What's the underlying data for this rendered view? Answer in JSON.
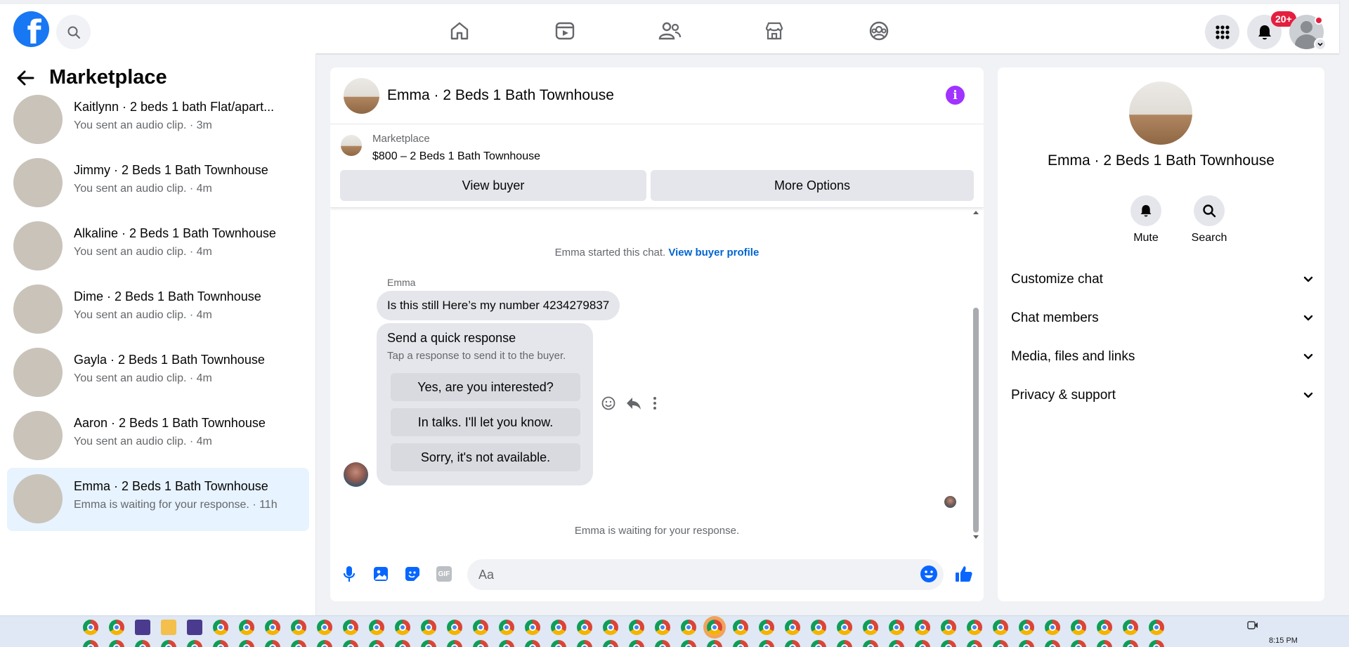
{
  "sidebar": {
    "title": "Marketplace",
    "conversations": [
      {
        "name": "Kaitlynn · 2 beds 1 bath Flat/apart...",
        "sub": "You sent an audio clip. · 3m",
        "thumb": "room-b"
      },
      {
        "name": "Jimmy · 2 Beds 1 Bath Townhouse",
        "sub": "You sent an audio clip. · 4m",
        "thumb": "room-a"
      },
      {
        "name": "Alkaline · 2 Beds 1 Bath Townhouse",
        "sub": "You sent an audio clip. · 4m",
        "thumb": "room-b"
      },
      {
        "name": "Dime · 2 Beds 1 Bath Townhouse",
        "sub": "You sent an audio clip. · 4m",
        "thumb": "room-b"
      },
      {
        "name": "Gayla · 2 Beds 1 Bath Townhouse",
        "sub": "You sent an audio clip. · 4m",
        "thumb": "room-b"
      },
      {
        "name": "Aaron · 2 Beds 1 Bath Townhouse",
        "sub": "You sent an audio clip. · 4m",
        "thumb": "room-b"
      },
      {
        "name": "Emma · 2 Beds 1 Bath Townhouse",
        "sub": "Emma is waiting for your response. · 11h",
        "thumb": "room-c",
        "active": true
      }
    ]
  },
  "topbar": {
    "notification_badge": "20+",
    "icons": [
      "facebook-logo",
      "search-icon",
      "home-icon",
      "video-icon",
      "friends-icon",
      "marketplace-icon",
      "groups-icon",
      "menu-grid-icon",
      "bell-icon",
      "avatar"
    ]
  },
  "chat": {
    "title": "Emma · 2 Beds 1 Bath Townhouse",
    "marketplace_label": "Marketplace",
    "listing": "$800 – 2 Beds 1 Bath Townhouse",
    "view_buyer": "View buyer",
    "more_options": "More Options",
    "started_text": "Emma started this chat.",
    "view_buyer_profile": "View buyer profile",
    "sender": "Emma",
    "message": "Is this still  Here’s my number 4234279837",
    "quick_response": {
      "heading": "Send a quick response",
      "subtitle": "Tap a response to send it to the buyer.",
      "options": [
        "Yes, are you interested?",
        "In talks. I'll let you know.",
        "Sorry, it's not available."
      ]
    },
    "waiting_text": "Emma is waiting for your response.",
    "input_placeholder": "Aa"
  },
  "info_panel": {
    "name": "Emma · 2 Beds 1 Bath Townhouse",
    "actions": [
      "Mute",
      "Search"
    ],
    "sections": [
      "Customize chat",
      "Chat members",
      "Media, files and links",
      "Privacy & support"
    ]
  },
  "taskbar": {
    "time": "8:15 PM"
  },
  "colors": {
    "brand": "#1877f2",
    "info": "#a033ff",
    "link": "#0064d1",
    "badge": "#e41e3f",
    "active_row": "#e7f3ff"
  }
}
